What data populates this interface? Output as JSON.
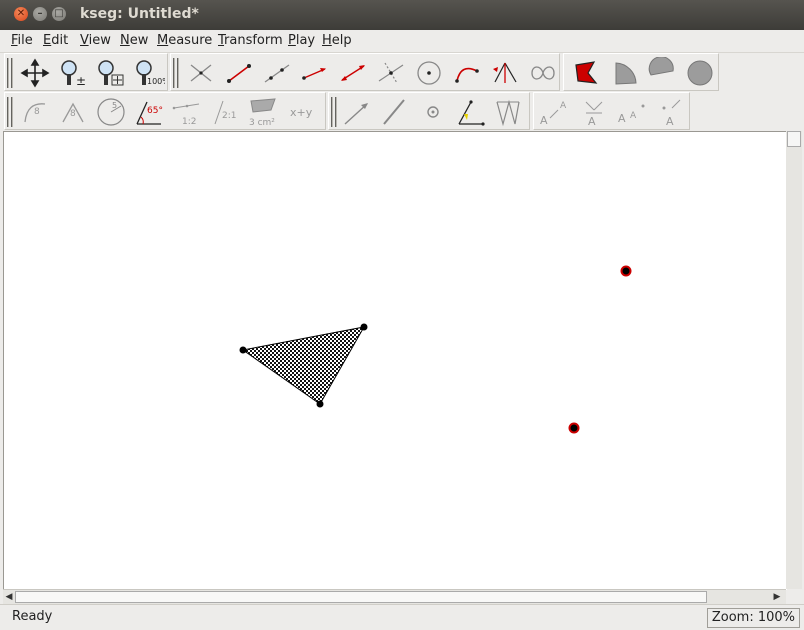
{
  "window": {
    "title": "kseg: Untitled*"
  },
  "menubar": {
    "items": [
      "File",
      "Edit",
      "View",
      "New",
      "Measure",
      "Transform",
      "Play",
      "Help"
    ]
  },
  "toolbar": {
    "row1": [
      "move-tool",
      "zoom-tool",
      "zoom-fit-tool",
      "zoom-100-tool",
      "intersection-tool",
      "segment-tool",
      "ray-tool",
      "vector-tool",
      "line-tool",
      "perpendicular-tool",
      "circle-tool",
      "arc-tool",
      "angle-bisector-tool",
      "locus-tool",
      "polygon-tool",
      "circle-sector-tool",
      "circle-segment-tool",
      "circle-interior-tool"
    ],
    "row2": [
      "arc-length-tool",
      "arc-angle-tool",
      "circle-radius-tool",
      "angle-measure-tool",
      "segment-ratio-tool",
      "ratio-tool",
      "area-tool",
      "calculate-tool",
      "translate-tool",
      "reflect-tool",
      "rotate-tool",
      "scale-tool",
      "iterate-tool",
      "text-tool-1",
      "text-tool-2",
      "text-tool-3",
      "text-tool-4"
    ],
    "angle_label": "65°",
    "ratio_label": "1:2",
    "ratio2_label": "2:1",
    "area_label": "3 cm²",
    "calc_label": "x+y"
  },
  "status": {
    "text": "Ready",
    "zoom": "Zoom: 100%"
  },
  "colors": {
    "accent_red": "#cc0000",
    "point_fill": "#000000",
    "point_outline_red": "#cc0000"
  }
}
